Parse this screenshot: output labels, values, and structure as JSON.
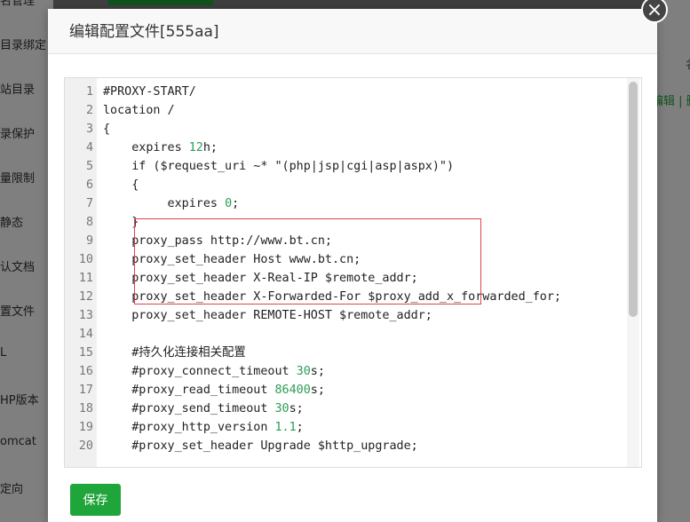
{
  "background": {
    "sidebar_items": [
      "名管理",
      "目录绑定",
      "站目录",
      "录保护",
      "量限制",
      "静态",
      "认文档",
      "置文件",
      "L",
      "HP版本",
      "omcat",
      "定向"
    ],
    "right_edit": "编辑 | 删",
    "right_char": "名"
  },
  "modal": {
    "title": "编辑配置文件[555aa]",
    "close_glyph": "×",
    "save_label": "保存"
  },
  "editor": {
    "lines": [
      {
        "n": "1",
        "t": "#PROXY-START/"
      },
      {
        "n": "2",
        "t": "location /"
      },
      {
        "n": "3",
        "t": "{"
      },
      {
        "n": "4",
        "t": "    expires ",
        "num": "12",
        "rest": "h;"
      },
      {
        "n": "5",
        "t": "    if ($request_uri ~* \"(php|jsp|cgi|asp|aspx)\")"
      },
      {
        "n": "6",
        "t": "    {"
      },
      {
        "n": "7",
        "t": "         expires ",
        "num": "0",
        "rest": ";"
      },
      {
        "n": "8",
        "t": "    }"
      },
      {
        "n": "9",
        "t": "    proxy_pass http://www.bt.cn;"
      },
      {
        "n": "10",
        "t": "    proxy_set_header Host www.bt.cn;"
      },
      {
        "n": "11",
        "t": "    proxy_set_header X-Real-IP $remote_addr;"
      },
      {
        "n": "12",
        "t": "    proxy_set_header X-Forwarded-For $proxy_add_x_forwarded_for;"
      },
      {
        "n": "13",
        "t": "    proxy_set_header REMOTE-HOST $remote_addr;"
      },
      {
        "n": "14",
        "t": ""
      },
      {
        "n": "15",
        "t": "    #持久化连接相关配置"
      },
      {
        "n": "16",
        "t": "    #proxy_connect_timeout ",
        "num": "30",
        "rest": "s;"
      },
      {
        "n": "17",
        "t": "    #proxy_read_timeout ",
        "num": "86400",
        "rest": "s;"
      },
      {
        "n": "18",
        "t": "    #proxy_send_timeout ",
        "num": "30",
        "rest": "s;"
      },
      {
        "n": "19",
        "t": "    #proxy_http_version ",
        "num": "1.1",
        "rest": ";"
      },
      {
        "n": "20",
        "t": "    #proxy_set_header Upgrade $http_upgrade;"
      }
    ]
  }
}
